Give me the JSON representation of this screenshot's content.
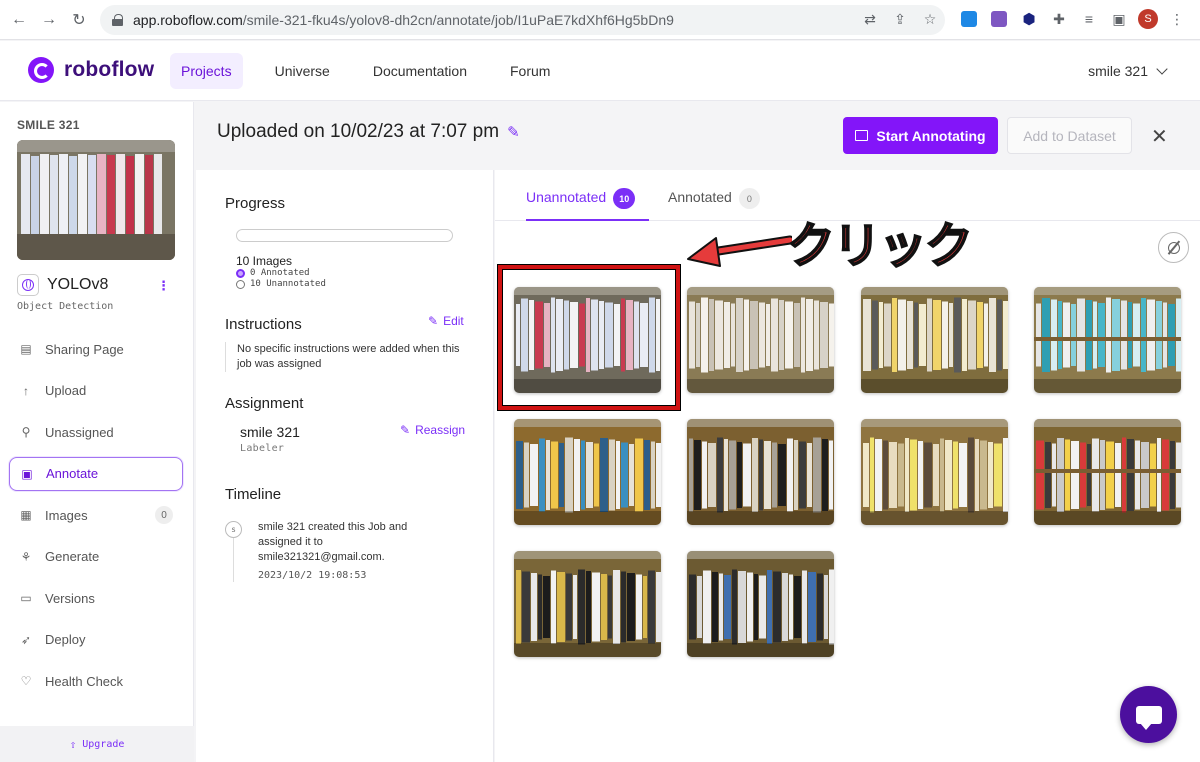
{
  "browser": {
    "url_host": "app.roboflow.com",
    "url_path": "/smile-321-fku4s/yolov8-dh2cn/annotate/job/I1uPaE7kdXhf6Hg5bDn9",
    "profile_initial": "S"
  },
  "header": {
    "brand": "roboflow",
    "nav": [
      {
        "label": "Projects",
        "active": true
      },
      {
        "label": "Universe",
        "active": false
      },
      {
        "label": "Documentation",
        "active": false
      },
      {
        "label": "Forum",
        "active": false
      }
    ],
    "user": "smile 321"
  },
  "sidebar": {
    "project_name": "SMILE 321",
    "model_name": "YOLOv8",
    "model_type": "Object Detection",
    "kebab": "⋮",
    "items": [
      {
        "label": "Sharing Page",
        "icon": "document-icon"
      },
      {
        "label": "Upload",
        "icon": "upload-icon"
      },
      {
        "label": "Unassigned",
        "icon": "search-icon"
      },
      {
        "label": "Annotate",
        "icon": "annotate-icon",
        "active": true
      },
      {
        "label": "Images",
        "icon": "images-icon",
        "count": "0"
      },
      {
        "label": "Generate",
        "icon": "generate-icon"
      },
      {
        "label": "Versions",
        "icon": "versions-icon"
      },
      {
        "label": "Deploy",
        "icon": "rocket-icon"
      },
      {
        "label": "Health Check",
        "icon": "heart-icon"
      }
    ],
    "upgrade": "Upgrade"
  },
  "job": {
    "title": "Uploaded on 10/02/23 at 7:07 pm",
    "start_button": "Start Annotating",
    "add_button": "Add to Dataset",
    "close": "✕"
  },
  "info": {
    "progress_heading": "Progress",
    "progress_fraction": 0,
    "images_count": "10 Images",
    "annotated": "0 Annotated",
    "unannotated": "10 Unannotated",
    "instructions_heading": "Instructions",
    "edit_label": "Edit",
    "instructions_text": "No specific instructions were added when this job was assigned",
    "assignment_heading": "Assignment",
    "assignee": "smile 321",
    "assignee_role": "Labeler",
    "reassign_label": "Reassign",
    "timeline_heading": "Timeline",
    "timeline_avatar": "s",
    "timeline_text": "smile 321 created this Job and assigned it to smile321321@gmail.com.",
    "timeline_time": "2023/10/2 19:08:53"
  },
  "gallery": {
    "tabs": [
      {
        "label": "Unannotated",
        "count": "10",
        "active": true
      },
      {
        "label": "Annotated",
        "count": "0",
        "active": false
      }
    ],
    "image_count": 10
  },
  "annotation": {
    "callout": "クリック",
    "color": "#e53b3b"
  },
  "colors": {
    "accent": "#8315f9",
    "brand_dark": "#3d0f7a"
  }
}
